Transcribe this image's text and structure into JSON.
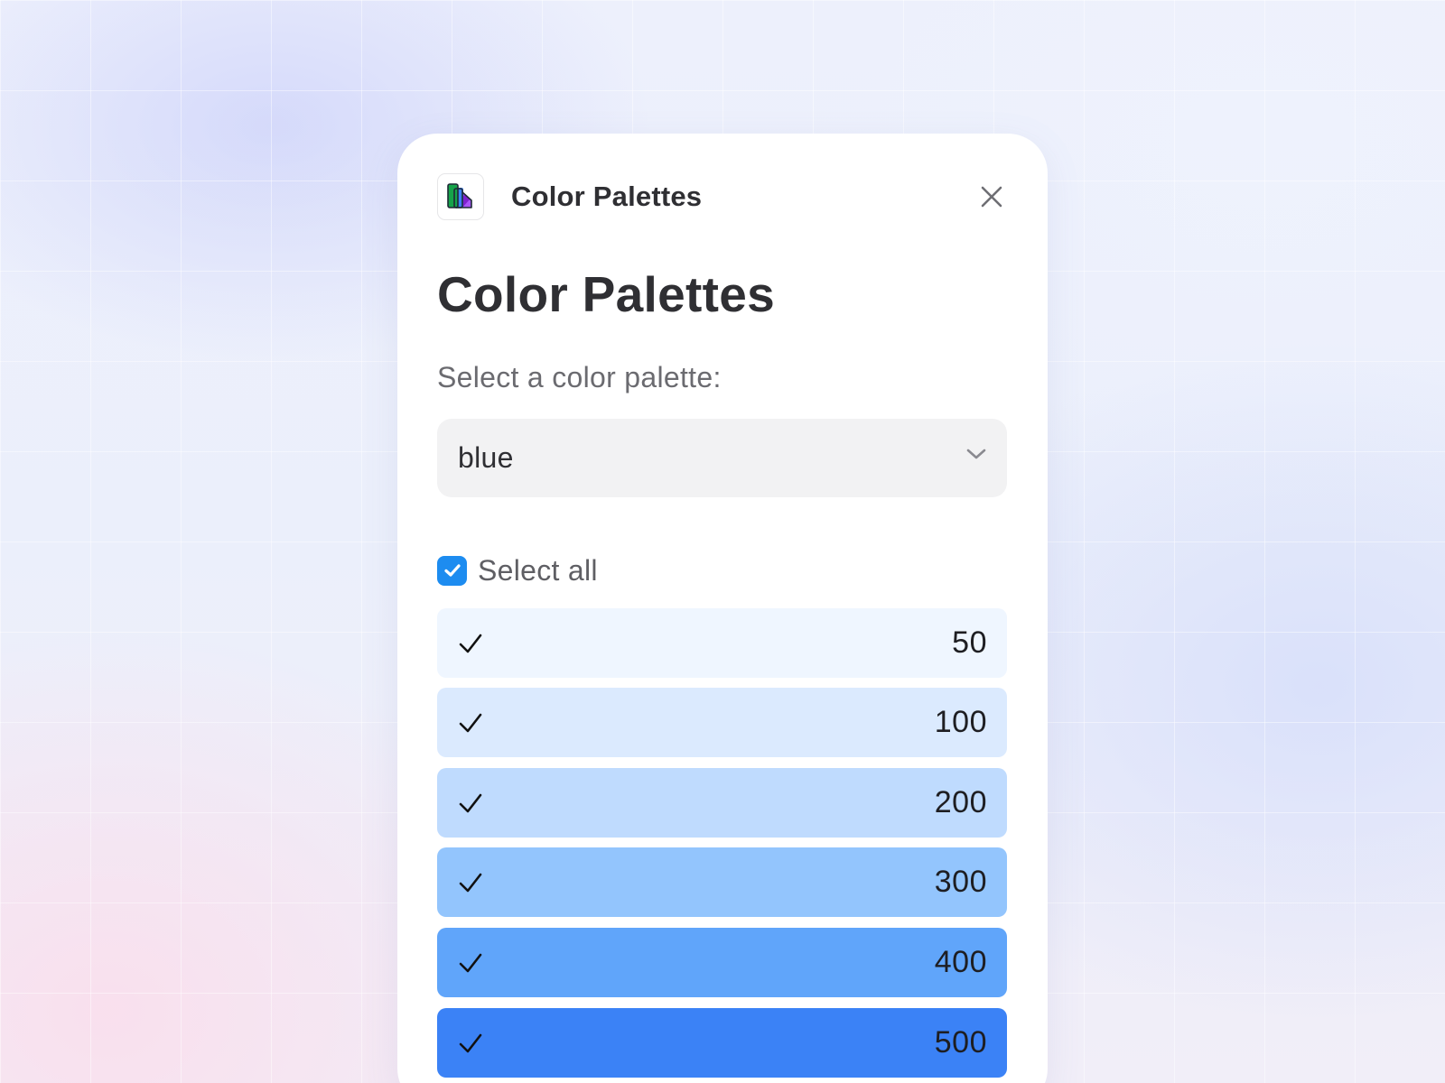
{
  "header": {
    "title": "Color Palettes",
    "app_icon": "palette-swatch-icon",
    "close_icon": "close-icon"
  },
  "main": {
    "title": "Color Palettes",
    "select_label": "Select a color palette:",
    "palette_select": {
      "value": "blue",
      "icon": "chevron-down-icon"
    },
    "select_all": {
      "label": "Select all",
      "checked": true
    },
    "swatches": [
      {
        "label": "50",
        "color": "#eff6ff",
        "checked": true
      },
      {
        "label": "100",
        "color": "#dbeafe",
        "checked": true
      },
      {
        "label": "200",
        "color": "#bfdbfe",
        "checked": true
      },
      {
        "label": "300",
        "color": "#93c5fd",
        "checked": true
      },
      {
        "label": "400",
        "color": "#60a5fa",
        "checked": true
      },
      {
        "label": "500",
        "color": "#3b82f6",
        "checked": true
      }
    ]
  },
  "colors": {
    "checkbox_accent": "#1d8cf0",
    "text_primary": "#2f2f33",
    "text_secondary": "#6b6b70"
  }
}
